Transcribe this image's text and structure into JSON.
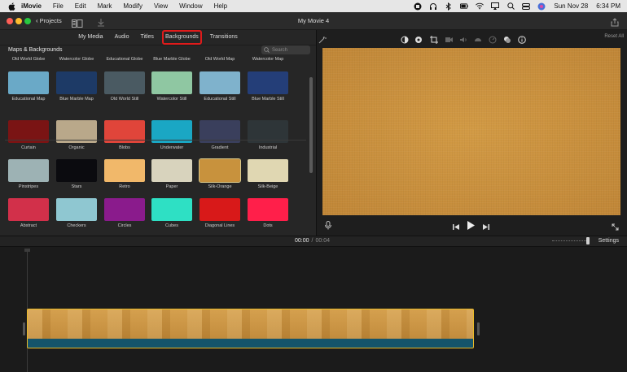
{
  "menubar": {
    "app_name": "iMovie",
    "menus": [
      "File",
      "Edit",
      "Mark",
      "Modify",
      "View",
      "Window",
      "Help"
    ],
    "date": "Sun Nov 28",
    "time": "6:34 PM"
  },
  "titlebar": {
    "projects_label": "Projects",
    "title": "My Movie 4"
  },
  "browser": {
    "tabs": [
      "My Media",
      "Audio",
      "Titles",
      "Backgrounds",
      "Transitions"
    ],
    "active_tab": "Backgrounds",
    "section_title": "Maps & Backgrounds",
    "search_placeholder": "Search",
    "items": [
      {
        "label": "Old World Globe",
        "color": "#3a3a3a"
      },
      {
        "label": "Watercolor Globe",
        "color": "#3a3a3a"
      },
      {
        "label": "Educational Globe",
        "color": "#3a3a3a"
      },
      {
        "label": "Blue Marble Globe",
        "color": "#3a3a3a"
      },
      {
        "label": "Old World Map",
        "color": "#3a3a3a"
      },
      {
        "label": "Watercolor Map",
        "color": "#3a3a3a"
      },
      {
        "label": "Educational Map",
        "color": "#6aa9c7"
      },
      {
        "label": "Blue Marble Map",
        "color": "#1d3a66"
      },
      {
        "label": "Old World Still",
        "color": "#4a5a62"
      },
      {
        "label": "Watercolor Still",
        "color": "#8fc7a2"
      },
      {
        "label": "Educational Still",
        "color": "#7fb2cc"
      },
      {
        "label": "Blue Marble Still",
        "color": "#243e78"
      },
      {
        "label": "Curtain",
        "color": "#7a1414"
      },
      {
        "label": "Organic",
        "color": "#b9a88a"
      },
      {
        "label": "Blobs",
        "color": "#e0453a"
      },
      {
        "label": "Underwater",
        "color": "#1aa7c4"
      },
      {
        "label": "Gradient",
        "color": "#3a3f5c"
      },
      {
        "label": "Industrial",
        "color": "#2e3538"
      },
      {
        "label": "Pinstripes",
        "color": "#9db2b4"
      },
      {
        "label": "Stars",
        "color": "#0b0b0f"
      },
      {
        "label": "Retro",
        "color": "#f1b86a"
      },
      {
        "label": "Paper",
        "color": "#d8d3bd"
      },
      {
        "label": "Silk-Orange",
        "color": "#c8923d"
      },
      {
        "label": "Silk-Beige",
        "color": "#e0d7b2"
      },
      {
        "label": "Abstract",
        "color": "#d2304a"
      },
      {
        "label": "Checkers",
        "color": "#8fc7d1"
      },
      {
        "label": "Circles",
        "color": "#8a1b8c"
      },
      {
        "label": "Cubes",
        "color": "#2ee0c4"
      },
      {
        "label": "Diagonal Lines",
        "color": "#d81919"
      },
      {
        "label": "Dots",
        "color": "#ff1f4a"
      }
    ],
    "selected_item": "Silk-Orange"
  },
  "viewer": {
    "reset_label": "Reset All",
    "frame_color": "#c8923d"
  },
  "timeline": {
    "current_time": "00:00",
    "separator": "/",
    "duration": "00:04",
    "settings_label": "Settings"
  },
  "colors": {
    "highlight": "#e01b1b",
    "clip_border": "#e8b928",
    "audio_track": "#14546b"
  }
}
